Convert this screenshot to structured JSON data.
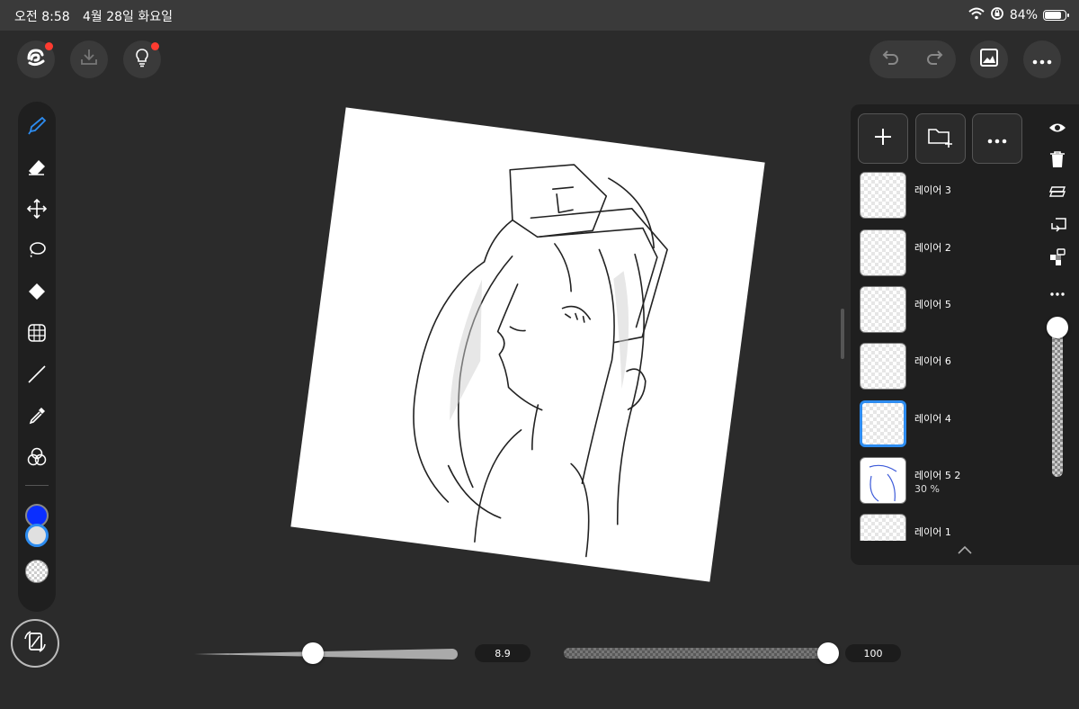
{
  "status_bar": {
    "time": "오전 8:58",
    "date": "4월 28일 화요일",
    "battery": "84%",
    "battery_level": 0.84
  },
  "top_bar": {
    "left_icons": [
      "app-logo-icon",
      "download-icon",
      "tips-bulb-icon"
    ],
    "right_icons": [
      "undo-icon",
      "redo-icon",
      "gallery-icon",
      "more-icon"
    ]
  },
  "tools": [
    "pen-icon",
    "eraser-icon",
    "move-icon",
    "lasso-icon",
    "fill-bucket-icon",
    "transform-icon",
    "line-icon",
    "eyedropper-icon",
    "color-mixer-icon"
  ],
  "colors": {
    "primary": "#0a2eff",
    "secondary": "#e0e0e0",
    "accent": "#2d8cf0"
  },
  "layers": [
    {
      "name": "레이어 3",
      "sub": "",
      "selected": false
    },
    {
      "name": "레이어 2",
      "sub": "",
      "selected": false
    },
    {
      "name": "레이어 5",
      "sub": "",
      "selected": false
    },
    {
      "name": "레이어 6",
      "sub": "",
      "selected": false
    },
    {
      "name": "레이어 4",
      "sub": "",
      "selected": true
    },
    {
      "name": "레이어 5 2",
      "sub": "30 %",
      "selected": false
    },
    {
      "name": "레이어 1",
      "sub": "",
      "selected": false
    }
  ],
  "layer_panel_icons": [
    "eye-icon",
    "trash-icon",
    "merge-layers-icon",
    "clipping-icon",
    "alpha-lock-icon",
    "more-dots-icon"
  ],
  "brush": {
    "size": "8.9",
    "size_fraction": 0.45,
    "opacity": "100",
    "opacity_fraction": 1.0
  }
}
